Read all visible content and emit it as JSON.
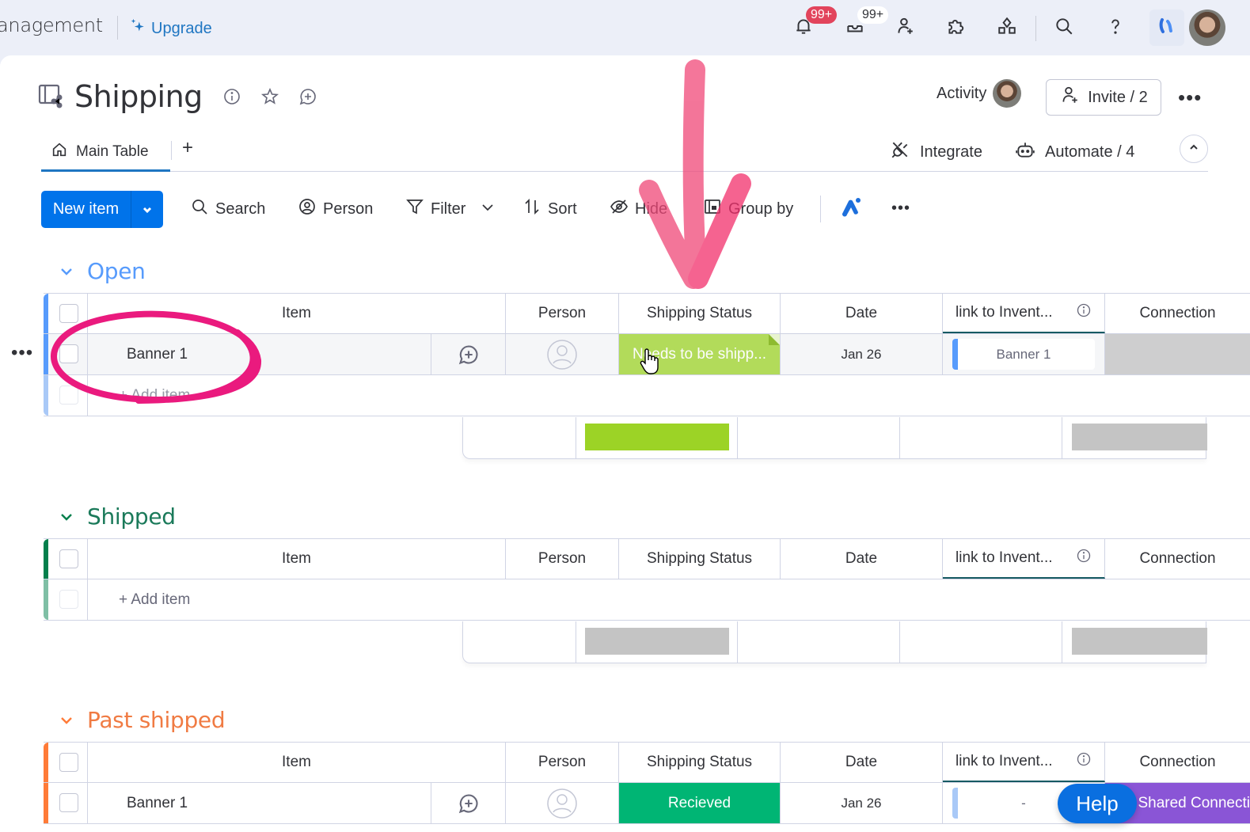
{
  "topbar": {
    "workspace_name": "anagement",
    "upgrade_label": "Upgrade",
    "notifications_badge": "99+",
    "inbox_badge": "99+",
    "icons": [
      "bell-icon",
      "inbox-icon",
      "invite-member-icon",
      "apps-icon",
      "integrations-icon",
      "search-icon",
      "help-icon",
      "brand-icon",
      "user-avatar"
    ]
  },
  "board": {
    "title": "Shipping",
    "activity_label": "Activity",
    "invite_label": "Invite / 2",
    "tabs": [
      {
        "label": "Main Table",
        "active": true
      }
    ],
    "add_tab_label": "+",
    "integrate_label": "Integrate",
    "automate_label": "Automate / 4"
  },
  "toolbar": {
    "new_item_label": "New item",
    "search_label": "Search",
    "person_label": "Person",
    "filter_label": "Filter",
    "sort_label": "Sort",
    "hide_label": "Hide",
    "group_by_label": "Group by"
  },
  "columns": {
    "item": "Item",
    "person": "Person",
    "status": "Shipping Status",
    "date": "Date",
    "link": "link to Invent...",
    "connection": "Connection"
  },
  "groups": [
    {
      "title": "Open",
      "color": "#579bfc",
      "items": [
        {
          "name": "Banner 1",
          "status": "Needs to be shipp...",
          "status_color": "#9cd326",
          "date": "Jan 26",
          "link": "Banner 1",
          "connection": ""
        }
      ],
      "add_item_label": "+ Add item",
      "summary_status_color": "#9cd326"
    },
    {
      "title": "Shipped",
      "color": "#037f4c",
      "items": [],
      "add_item_label": "+ Add item",
      "summary_status_color": "#c4c4c4"
    },
    {
      "title": "Past shipped",
      "color": "#ff7b38",
      "items": [
        {
          "name": "Banner 1",
          "status": "Recieved",
          "status_color": "#00c875",
          "date": "Jan 26",
          "link": "-",
          "connection": "Shared Connecti"
        }
      ]
    }
  ],
  "help_label": "Help"
}
